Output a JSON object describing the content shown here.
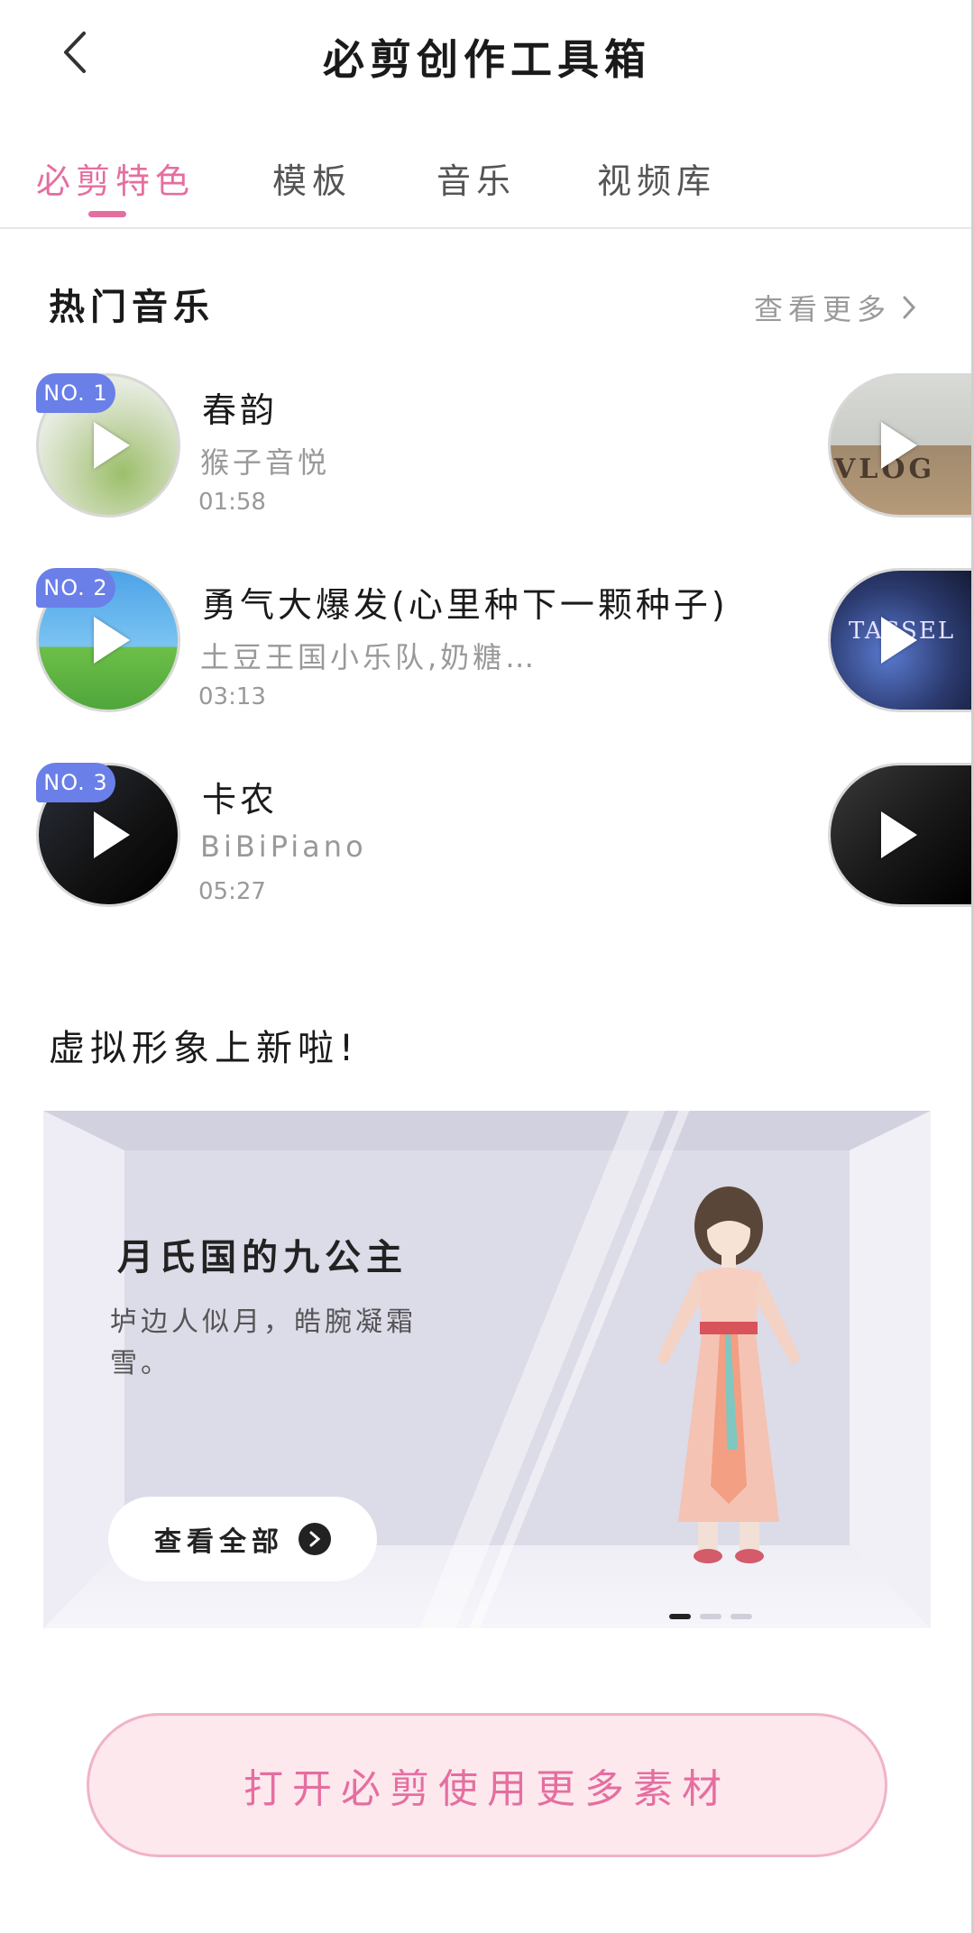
{
  "header": {
    "title": "必剪创作工具箱"
  },
  "tabs": [
    {
      "label": "必剪特色",
      "active": true
    },
    {
      "label": "模板",
      "active": false
    },
    {
      "label": "音乐",
      "active": false
    },
    {
      "label": "视频库",
      "active": false
    }
  ],
  "hot_music": {
    "title": "热门音乐",
    "more_label": "查看更多",
    "songs": [
      {
        "rank": "NO. 1",
        "title": "春韵",
        "artist": "猴子音悦",
        "duration": "01:58"
      },
      {
        "rank": "NO. 2",
        "title": "勇气大爆发(心里种下一颗种子)",
        "artist": "土豆王国小乐队,奶糖…",
        "duration": "03:13"
      },
      {
        "rank": "NO. 3",
        "title": "卡农",
        "artist": "BiBiPiano",
        "duration": "05:27"
      }
    ],
    "side_labels": [
      "VLOG",
      "TASSEL"
    ]
  },
  "avatar": {
    "section_title": "虚拟形象上新啦!",
    "banner_title": "月氏国的九公主",
    "banner_desc": "垆边人似月，皓腕凝霜雪。",
    "button_label": "查看全部",
    "carousel_total": 3,
    "carousel_active": 1
  },
  "cta": {
    "label": "打开必剪使用更多素材"
  },
  "colors": {
    "accent": "#e56ea0",
    "rank_badge": "#6b7fe8",
    "cta_bg": "#fde8ee"
  }
}
